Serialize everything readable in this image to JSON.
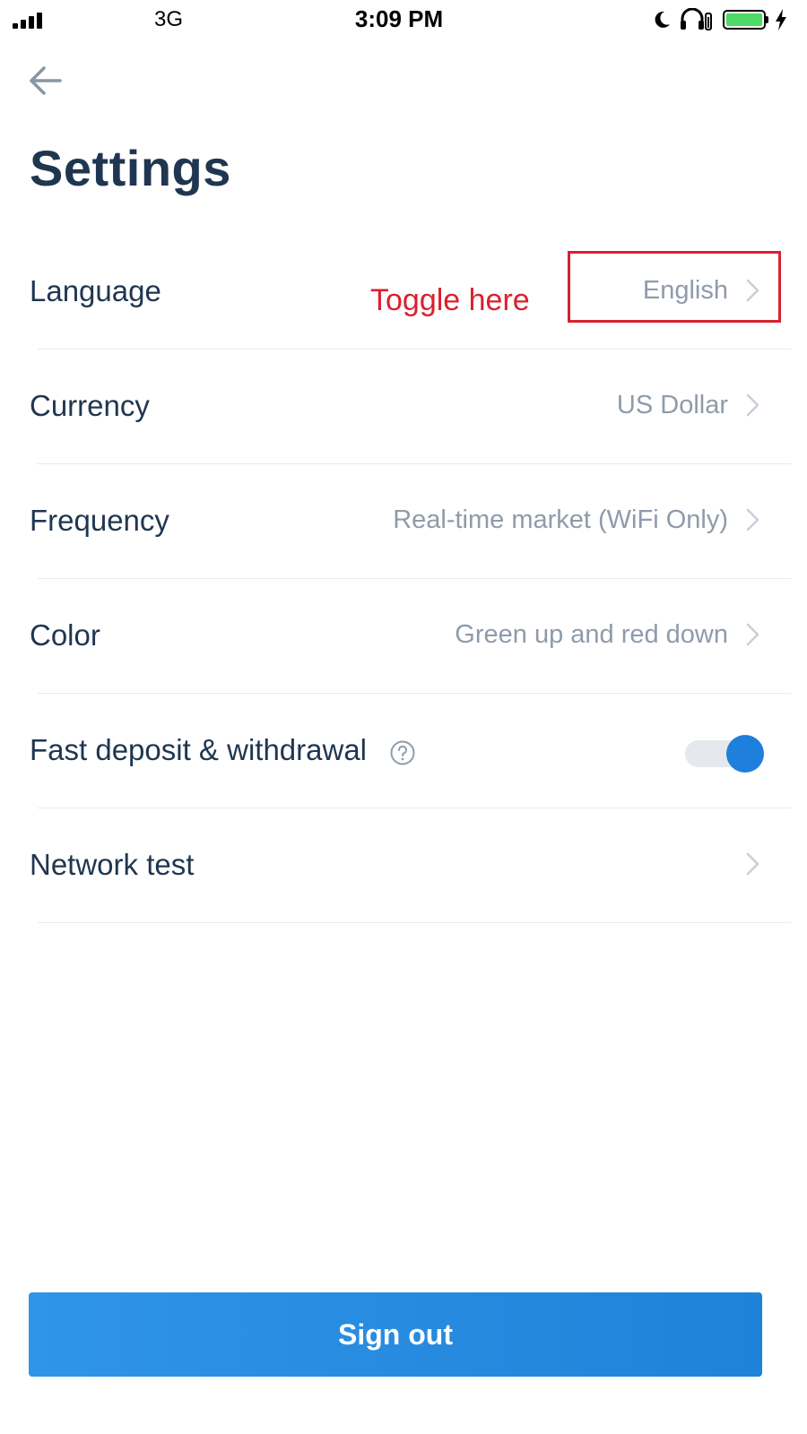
{
  "status_bar": {
    "network": "3G",
    "time": "3:09 PM",
    "icons": [
      "signal-icon",
      "moon-icon",
      "headphone-icon",
      "battery-icon",
      "charging-icon"
    ],
    "battery_color": "#4cd964"
  },
  "header": {
    "back_icon": "arrow-left-icon",
    "title": "Settings"
  },
  "settings": {
    "language": {
      "label": "Language",
      "value": "English"
    },
    "currency": {
      "label": "Currency",
      "value": "US Dollar"
    },
    "frequency": {
      "label": "Frequency",
      "value": "Real-time market (WiFi Only)"
    },
    "color": {
      "label": "Color",
      "value": "Green up and red down"
    },
    "fast_deposit": {
      "label": "Fast deposit & withdrawal",
      "toggle_on": true,
      "help_icon": "question-circle-icon"
    },
    "network_test": {
      "label": "Network test"
    }
  },
  "annotation": {
    "text": "Toggle here",
    "color": "#d9212e"
  },
  "footer": {
    "sign_out_label": "Sign out",
    "accent": "#1f82d9"
  }
}
